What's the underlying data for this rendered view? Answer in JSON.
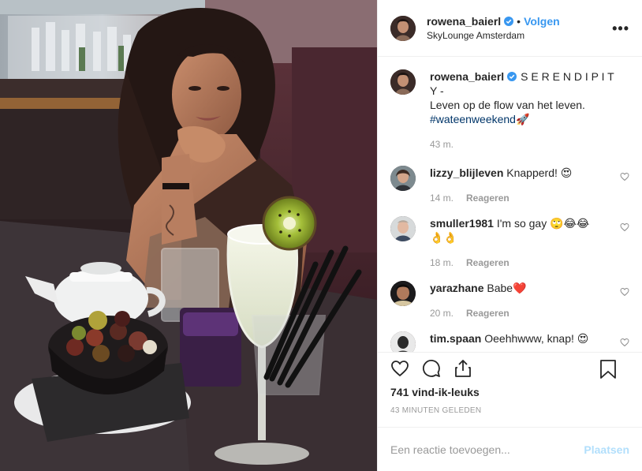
{
  "post": {
    "username": "rowena_baierl",
    "verified": true,
    "separator": "•",
    "follow_label": "Volgen",
    "location": "SkyLounge Amsterdam",
    "more_icon": "more-horizontal-icon"
  },
  "caption": {
    "username": "rowena_baierl",
    "text_line1": "S E R E N D I P I T Y -",
    "text_line2": "Leven op de flow van het leven.",
    "hashtag": "#wateenweekend",
    "emoji": "🚀",
    "time": "43 m."
  },
  "comments": [
    {
      "username": "lizzy_blijleven",
      "text": "Knapperd! 😍",
      "time": "14 m.",
      "reply": "Reageren"
    },
    {
      "username": "smuller1981",
      "text": "I'm so gay 🙄😂😂",
      "text2": "👌👌",
      "time": "18 m.",
      "reply": "Reageren"
    },
    {
      "username": "yarazhane",
      "text": "Babe❤️",
      "time": "20 m.",
      "reply": "Reageren"
    },
    {
      "username": "tim.spaan",
      "text": "Oeehhwww, knap! 😍",
      "time": "",
      "reply": ""
    }
  ],
  "actions": {
    "likes": "741 vind-ik-leuks",
    "ago": "43 MINUTEN GELEDEN",
    "comment_placeholder": "Een reactie toevoegen...",
    "post_label": "Plaatsen"
  },
  "colors": {
    "link_blue": "#3897f0",
    "muted": "#999999",
    "post_disabled": "#b2dffc",
    "verified_badge": "#3897f0"
  }
}
